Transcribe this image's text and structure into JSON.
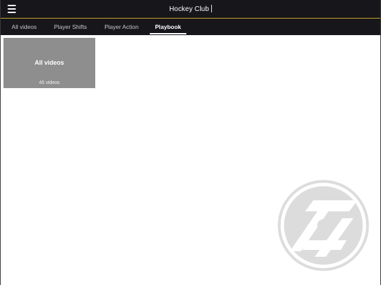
{
  "app": {
    "title": "Hockey Club"
  },
  "tabs": [
    {
      "label": "All videos",
      "active": false
    },
    {
      "label": "Player Shifts",
      "active": false
    },
    {
      "label": "Player Action",
      "active": false
    },
    {
      "label": "Playbook",
      "active": true
    }
  ],
  "grid": {
    "cards": [
      {
        "title": "All videos",
        "count": "45 videos"
      }
    ]
  },
  "colors": {
    "topbar_bg": "#17171b",
    "accent_line": "#c9a227",
    "card_bg": "#8e8e8e",
    "watermark": "#dcdcdc"
  },
  "icons": {
    "menu": "hamburger-menu-icon",
    "watermark": "club-logo-watermark"
  }
}
